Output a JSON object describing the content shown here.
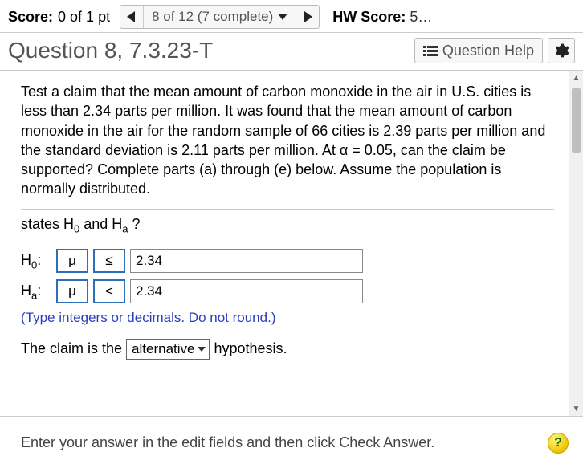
{
  "header": {
    "score_label": "Score:",
    "score_value": "0 of 1 pt",
    "nav_text": "8 of 12 (7 complete)",
    "hw_label": "HW Score:",
    "hw_value": "5…"
  },
  "title": "Question 8, 7.3.23-T",
  "help_label": "Question Help",
  "problem": "Test a claim that the mean amount of carbon monoxide in the air in U.S. cities is less than 2.34 parts per million. It was found that the mean amount of carbon monoxide in the air for the random sample of 66 cities is 2.39 parts per million and the standard deviation is 2.11 parts per million. At α = 0.05, can the claim be supported? Complete parts (a) through (e) below. Assume the population is normally distributed.",
  "subprompt_prefix": "states H",
  "subprompt_mid": " and H",
  "subprompt_suffix": " ?",
  "h0_param": "μ",
  "h0_rel": "≤",
  "h0_val": "2.34",
  "ha_param": "μ",
  "ha_rel": "<",
  "ha_val": "2.34",
  "hint": "(Type integers or decimals. Do not round.)",
  "claim_pre": "The claim is the ",
  "claim_sel": "alternative",
  "claim_post": " hypothesis.",
  "footer_text": "Enter your answer in the edit fields and then click Check Answer.",
  "help_badge": "?"
}
